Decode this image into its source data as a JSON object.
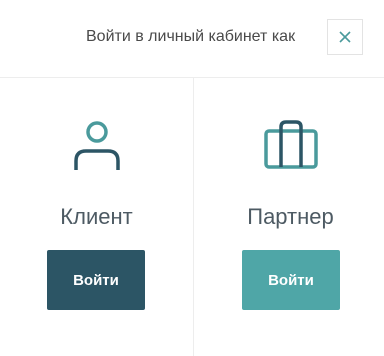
{
  "header": {
    "title": "Войти в личный кабинет как",
    "close_icon": "close-icon"
  },
  "roles": [
    {
      "icon": "user-icon",
      "label": "Клиент",
      "button_label": "Войти",
      "button_color": "#2c5565"
    },
    {
      "icon": "briefcase-icon",
      "label": "Партнер",
      "button_label": "Войти",
      "button_color": "#4fa6a7"
    }
  ],
  "colors": {
    "accent": "#4a9a9c",
    "text": "#4d5a63",
    "divider": "#ededed"
  }
}
